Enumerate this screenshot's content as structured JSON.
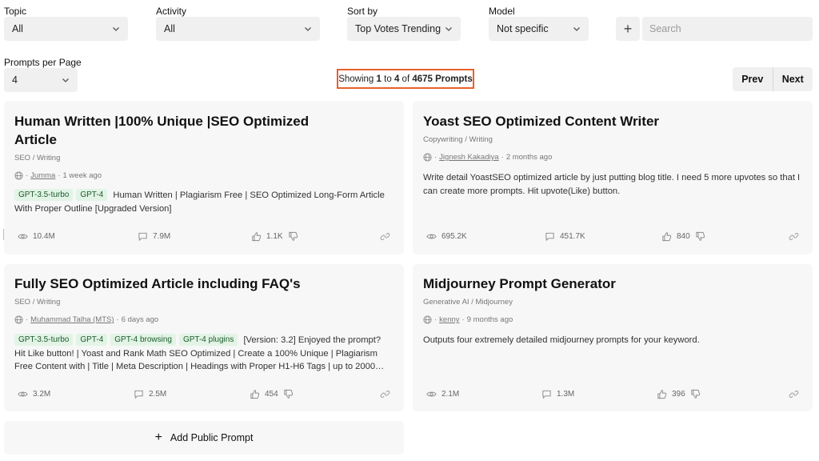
{
  "filters": {
    "topic": {
      "label": "Topic",
      "value": "All"
    },
    "activity": {
      "label": "Activity",
      "value": "All"
    },
    "sort_by": {
      "label": "Sort by",
      "value": "Top Votes Trending"
    },
    "model": {
      "label": "Model",
      "value": "Not specific"
    },
    "search_placeholder": "Search",
    "per_page": {
      "label": "Prompts per Page",
      "value": "4"
    }
  },
  "showing": {
    "prefix": "Showing",
    "from": "1",
    "to_word": "to",
    "to": "4",
    "of_word": "of",
    "total": "4675 Prompts"
  },
  "pager": {
    "prev": "Prev",
    "next": "Next"
  },
  "cards": [
    {
      "title_line1": "Human Written |100% Unique |SEO Optimized",
      "title_line2": "Article",
      "category": "SEO / Writing",
      "author": "Jumma",
      "time": "1 week ago",
      "tags": [
        "GPT-3.5-turbo",
        "GPT-4"
      ],
      "description": "Human Written | Plagiarism Free | SEO Optimized Long-Form Article With Proper Outline [Upgraded Version]",
      "views": "10.4M",
      "comments": "7.9M",
      "likes": "1.1K"
    },
    {
      "title_line1": "Yoast SEO Optimized Content Writer",
      "category": "Copywriting / Writing",
      "author": "Jignesh Kakadiya",
      "time": "2 months ago",
      "tags": [],
      "description": "Write detail YoastSEO optimized article by just putting blog title. I need 5 more upvotes so that I can create more prompts. Hit upvote(Like) button.",
      "views": "695.2K",
      "comments": "451.7K",
      "likes": "840"
    },
    {
      "title_line1": "Fully SEO Optimized Article including FAQ's",
      "category": "SEO / Writing",
      "author": "Muhammad Talha (MTS)",
      "time": "6 days ago",
      "tags": [
        "GPT-3.5-turbo",
        "GPT-4",
        "GPT-4 browsing",
        "GPT-4 plugins"
      ],
      "description": "[Version: 3.2] Enjoyed the prompt? Hit Like button! | Yoast and Rank Math SEO Optimized | Create a 100% Unique | Plagiarism Free Content with | Title | Meta Description | Headings with Proper H1-H6 Tags | up to 2000…",
      "views": "3.2M",
      "comments": "2.5M",
      "likes": "454"
    },
    {
      "title_line1": "Midjourney Prompt Generator",
      "category": "Generative AI / Midjourney",
      "author": "kenny",
      "time": "9 months ago",
      "tags": [],
      "description": "Outputs four extremely detailed midjourney prompts for your keyword.",
      "views": "2.1M",
      "comments": "1.3M",
      "likes": "396"
    }
  ],
  "add_prompt": "Add Public Prompt",
  "colors": {
    "highlight": "#e8602c",
    "tag_bg": "#e2f4e6",
    "card_bg": "#f7f7f7",
    "control_bg": "#f0f0f0"
  },
  "icons": [
    "chevron-down-icon",
    "plus-icon",
    "globe-icon",
    "eye-icon",
    "comment-icon",
    "thumbs-up-icon",
    "thumbs-down-icon",
    "link-icon"
  ]
}
